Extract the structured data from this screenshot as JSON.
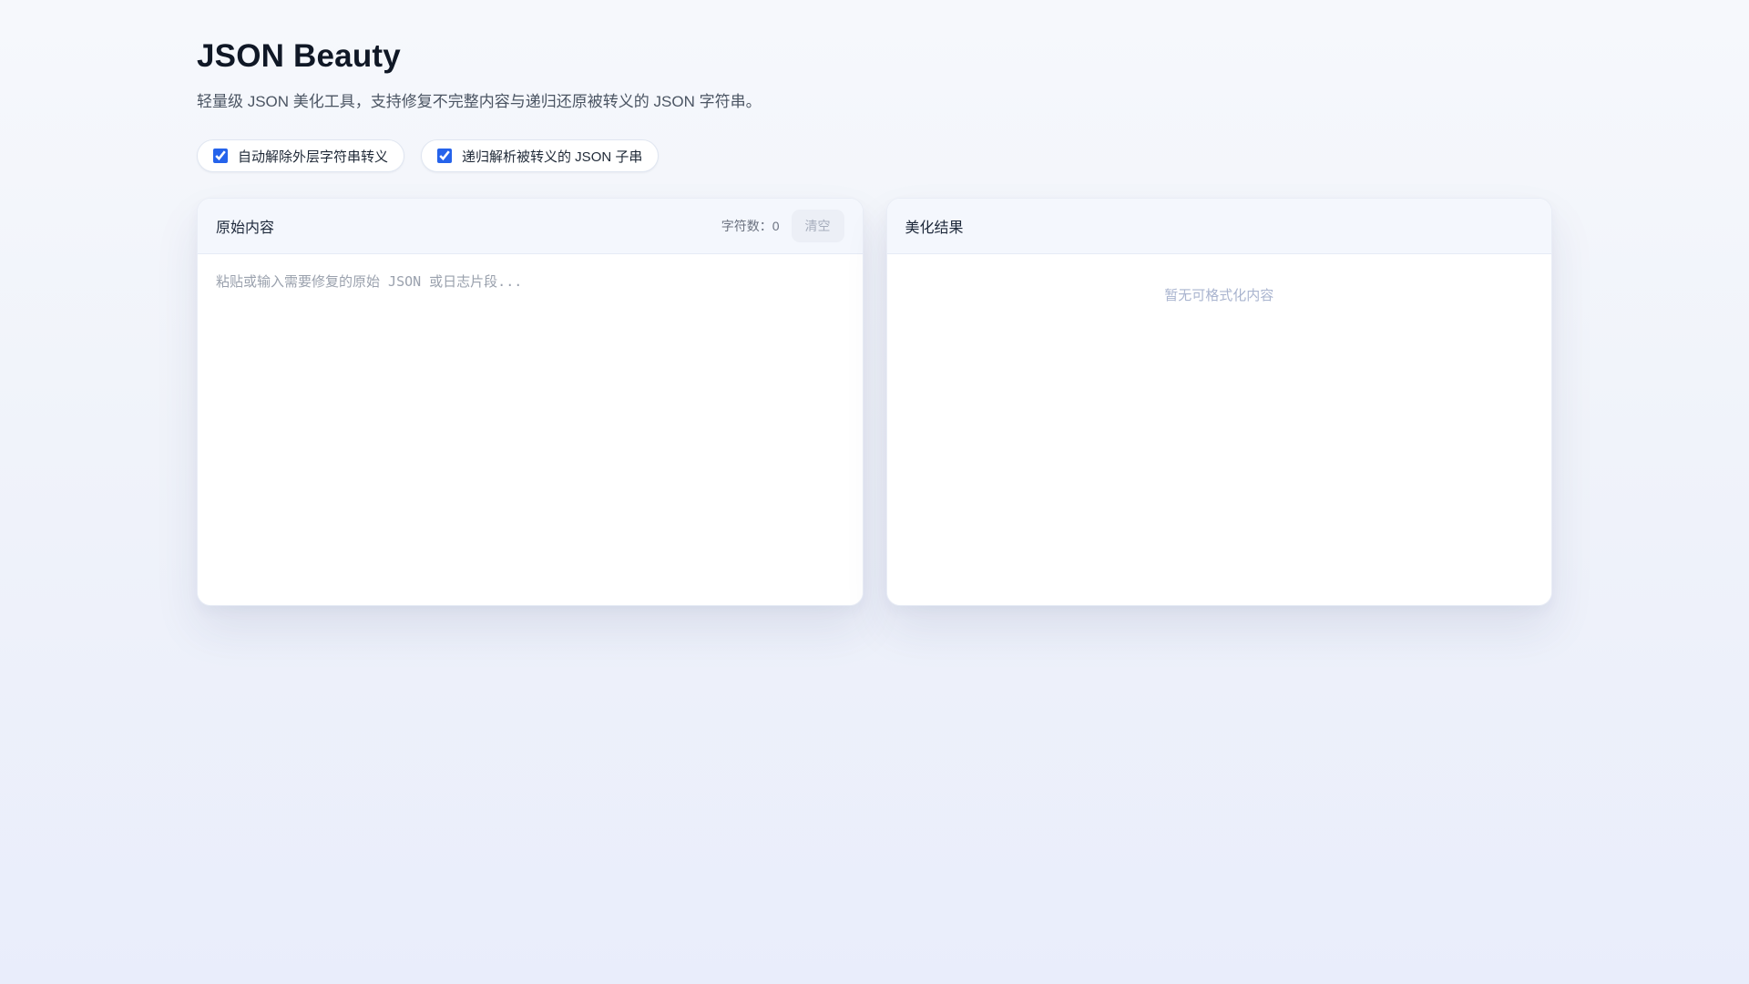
{
  "page": {
    "title": "JSON Beauty",
    "subtitle": "轻量级 JSON 美化工具，支持修复不完整内容与递归还原被转义的 JSON 字符串。"
  },
  "options": [
    {
      "label": "自动解除外层字符串转义",
      "checked": true
    },
    {
      "label": "递归解析被转义的 JSON 子串",
      "checked": true
    }
  ],
  "source_panel": {
    "title": "原始内容",
    "char_count_label": "字符数：",
    "char_count": "0",
    "clear_button_label": "清空",
    "textarea_value": "",
    "textarea_placeholder": "粘贴或输入需要修复的原始 JSON 或日志片段..."
  },
  "result_panel": {
    "title": "美化结果",
    "empty_text": "暂无可格式化内容"
  },
  "colors": {
    "accent_blue": "#2563eb",
    "background_top": "#f6f8fc",
    "background_bottom": "#e9edfb",
    "panel_header_bg": "#f4f7fd"
  }
}
